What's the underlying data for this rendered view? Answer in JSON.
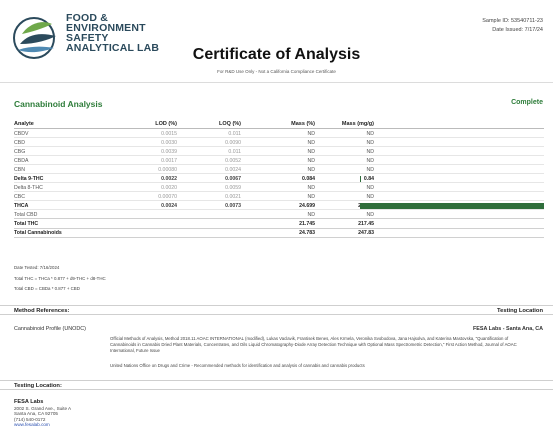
{
  "header": {
    "logo_lines": [
      "FOOD &",
      "ENVIRONMENT",
      "SAFETY",
      "ANALYTICAL LAB"
    ],
    "sample_id": "Sample ID: 53540711-23",
    "date_issued": "Date Issued: 7/17/24",
    "title": "Certificate of Analysis",
    "subtitle": "For R&D Use Only - Not a California Compliance Certificate"
  },
  "cannabinoid": {
    "section_title": "Cannabinoid Analysis",
    "status": "Complete",
    "columns": [
      "Analyte",
      "LOD (%)",
      "LOQ (%)",
      "Mass (%)",
      "Mass (mg/g)"
    ],
    "rows": [
      {
        "analyte": "CBDV",
        "lod": "0.0015",
        "loq": "0.011",
        "mass_pct": "ND",
        "mass_mg": "ND",
        "bold": false
      },
      {
        "analyte": "CBD",
        "lod": "0.0030",
        "loq": "0.0090",
        "mass_pct": "ND",
        "mass_mg": "ND",
        "bold": false
      },
      {
        "analyte": "CBG",
        "lod": "0.0039",
        "loq": "0.011",
        "mass_pct": "ND",
        "mass_mg": "ND",
        "bold": false
      },
      {
        "analyte": "CBDA",
        "lod": "0.0017",
        "loq": "0.0052",
        "mass_pct": "ND",
        "mass_mg": "ND",
        "bold": false
      },
      {
        "analyte": "CBN",
        "lod": "0.00080",
        "loq": "0.0024",
        "mass_pct": "ND",
        "mass_mg": "ND",
        "bold": false
      },
      {
        "analyte": "Delta 9-THC",
        "lod": "0.0022",
        "loq": "0.0067",
        "mass_pct": "0.084",
        "mass_mg": "0.84",
        "bold": true
      },
      {
        "analyte": "Delta 8-THC",
        "lod": "0.0020",
        "loq": "0.0059",
        "mass_pct": "ND",
        "mass_mg": "ND",
        "bold": false
      },
      {
        "analyte": "CBC",
        "lod": "0.00070",
        "loq": "0.0021",
        "mass_pct": "ND",
        "mass_mg": "ND",
        "bold": false
      },
      {
        "analyte": "THCA",
        "lod": "0.0024",
        "loq": "0.0073",
        "mass_pct": "24.699",
        "mass_mg": "246.99",
        "bold": true
      },
      {
        "analyte": "Total CBD",
        "lod": "",
        "loq": "",
        "mass_pct": "ND",
        "mass_mg": "ND",
        "bold": false
      },
      {
        "analyte": "Total THC",
        "lod": "",
        "loq": "",
        "mass_pct": "21.745",
        "mass_mg": "217.45",
        "bold": true
      },
      {
        "analyte": "Total Cannabinoids",
        "lod": "",
        "loq": "",
        "mass_pct": "24.783",
        "mass_mg": "247.83",
        "bold": true
      }
    ],
    "bar_fraction": {
      "Delta 9-THC": 0.0034,
      "THCA": 1.0
    },
    "bar_color": "#2f6e3b",
    "date_tested": "Date Tested: 7/16/2024",
    "formula_thc": "Total THC = THCa * 0.877 + d9-THC + d8-THC",
    "formula_cbd": "Total CBD = CBDa * 0.877 + CBD"
  },
  "method": {
    "header_left": "Method References:",
    "header_right": "Testing Location",
    "label": "Cannabinoid Profile (UNODC)",
    "lab": "FESA Labs - Santa Ana, CA",
    "reference": "Official Methods of Analysis, Method 2018.11 AOAC INTERNATIONAL (modified), Lukas Vaclavik, Frantisek Benes, Ales Krmela, Veronika Svobodova, Jana Hajsolva, and Katerina Mastovska, \"Quantification of Cannabinoids in Cannabis Dried Plant Materials, Concentrates, and Oils Liquid Chromatography-Diode Array Detection Technique with Optional Mass Spectrometric Detection,\" First Action Method, Journal of AOAC International, Future Issue",
    "reference2": "United Nations Office on Drugs and Crime - Recommended methods for identification and analysis of cannabis and cannabis products"
  },
  "testing_location": {
    "header": "Testing Location:",
    "name": "FESA Labs",
    "address1": "2002 S. Grand Ave., Suite A",
    "address2": "Santa Ana, CA 92705",
    "phone": "(714) 540-0172",
    "website": "www.fesalab.com"
  }
}
